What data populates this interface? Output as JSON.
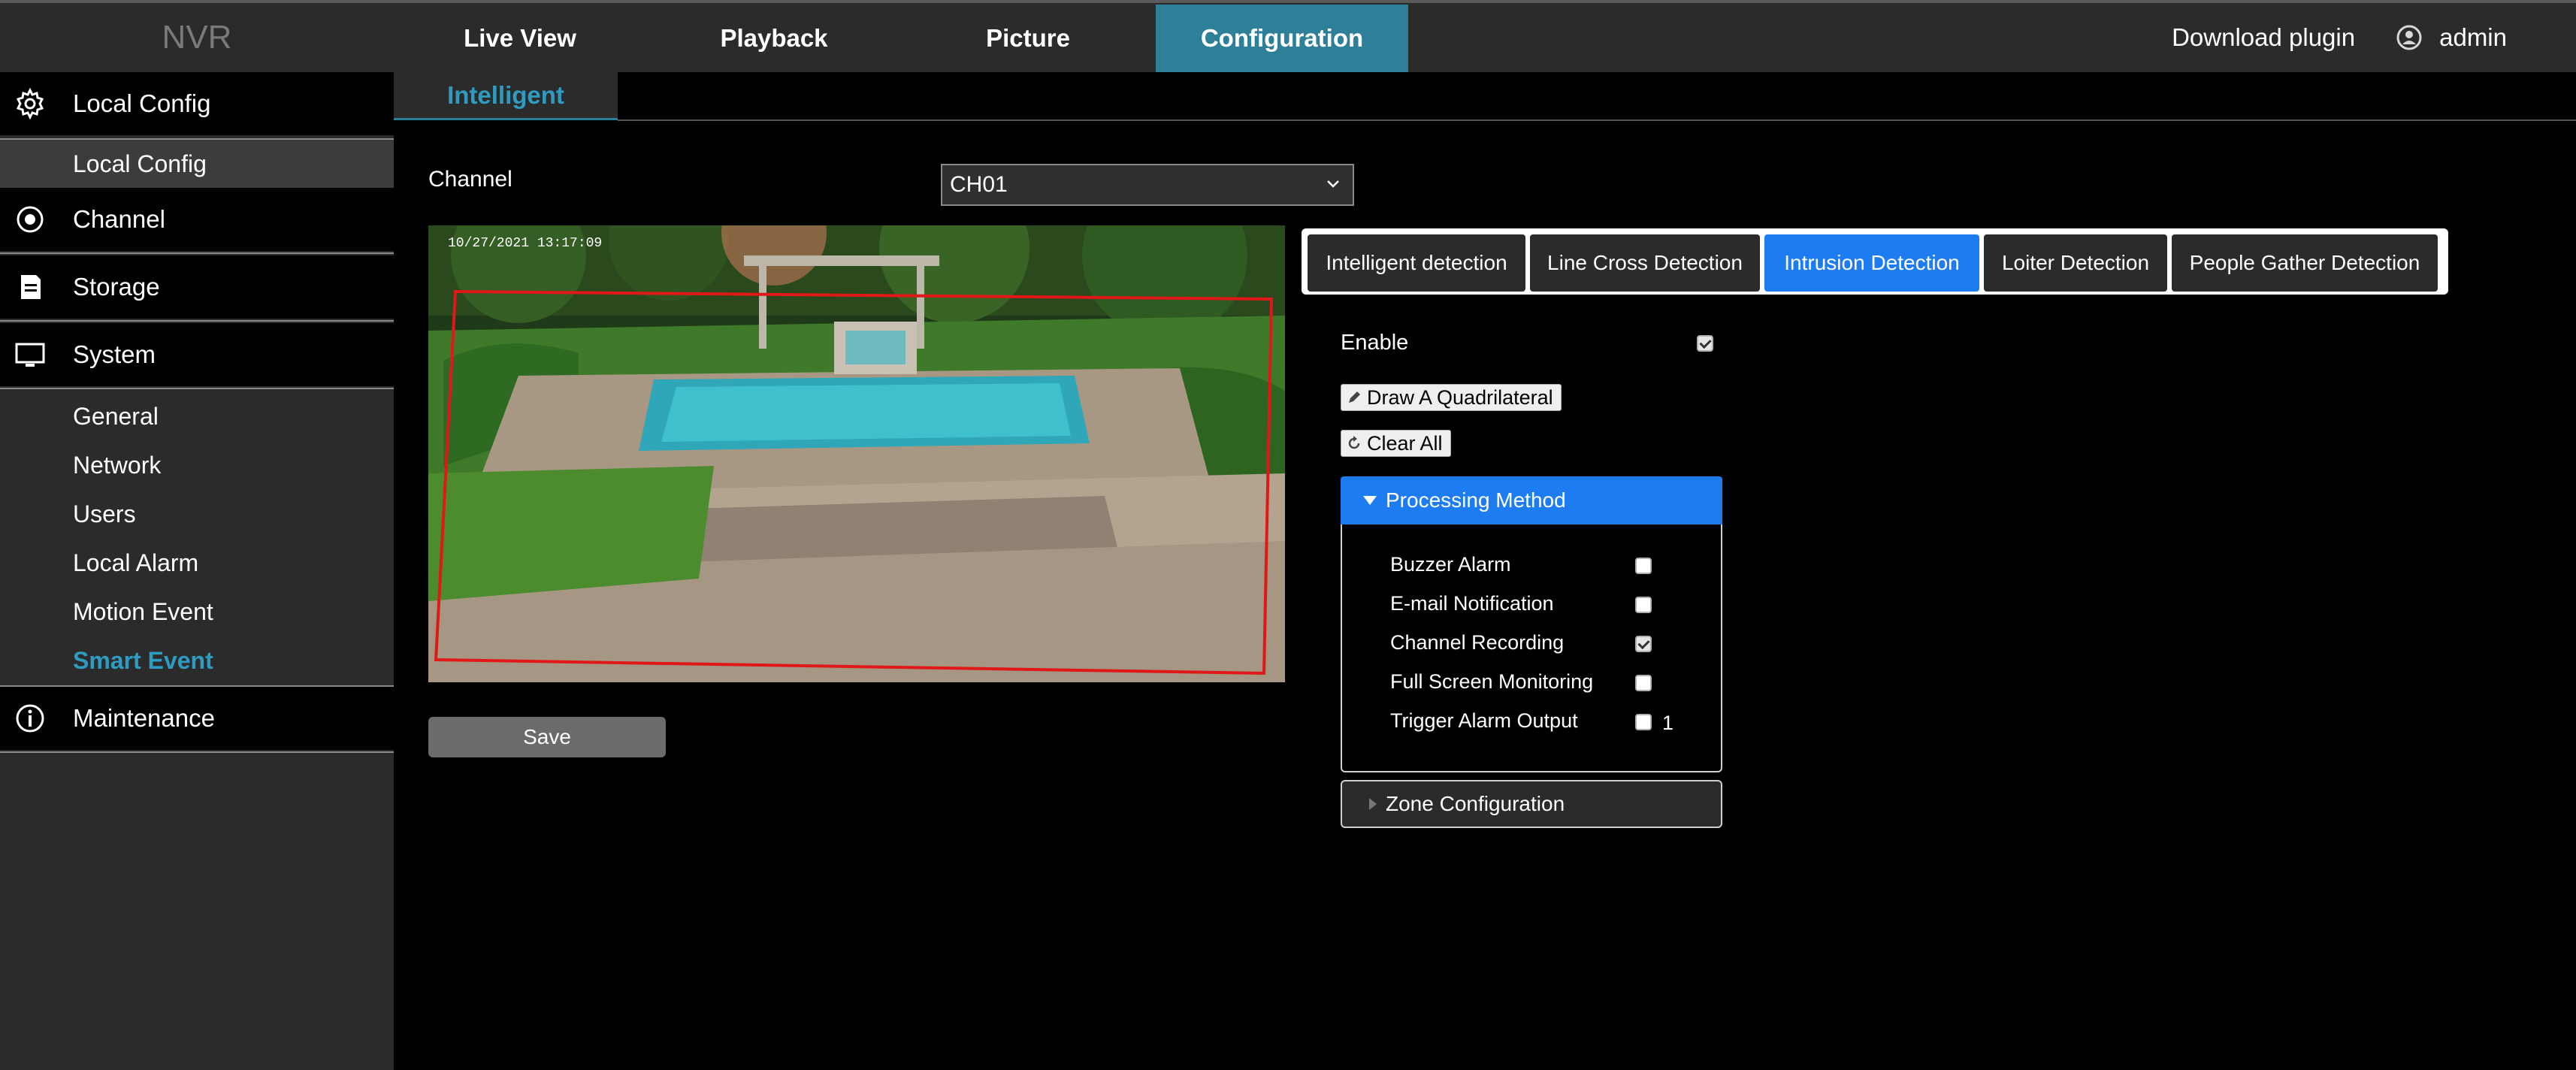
{
  "app": {
    "logo": "NVR",
    "top_nav": [
      "Live View",
      "Playback",
      "Picture",
      "Configuration"
    ],
    "active_top_nav": "Configuration",
    "download_plugin": "Download plugin",
    "user": "admin"
  },
  "sidebar": {
    "local_config": "Local Config",
    "local_config_sub": "Local Config",
    "channel": "Channel",
    "storage": "Storage",
    "system": "System",
    "system_items": [
      "General",
      "Network",
      "Users",
      "Local Alarm",
      "Motion Event",
      "Smart Event"
    ],
    "active_item": "Smart Event",
    "maintenance": "Maintenance"
  },
  "content": {
    "subtab": "Intelligent",
    "channel_label": "Channel",
    "channel_value": "CH01",
    "preview_timestamp": "10/27/2021  13:17:09",
    "save_label": "Save"
  },
  "detection": {
    "tabs": [
      "Intelligent detection",
      "Line Cross Detection",
      "Intrusion Detection",
      "Loiter Detection",
      "People Gather Detection"
    ],
    "active_tab": "Intrusion Detection",
    "enable_label": "Enable",
    "enable_checked": true,
    "draw_label": "Draw A Quadrilateral",
    "clear_label": "Clear All",
    "processing_method": "Processing Method",
    "options": [
      {
        "label": "Buzzer Alarm",
        "checked": false
      },
      {
        "label": "E-mail Notification",
        "checked": false
      },
      {
        "label": "Channel Recording",
        "checked": true
      },
      {
        "label": "Full Screen Monitoring",
        "checked": false
      },
      {
        "label": "Trigger Alarm Output",
        "checked": false
      }
    ],
    "alarm_output_number": "1",
    "zone_configuration": "Zone Configuration"
  },
  "colors": {
    "accent_teal": "#2e7f98",
    "active_blue": "#1e7cf2",
    "zone_red": "#e01818"
  }
}
